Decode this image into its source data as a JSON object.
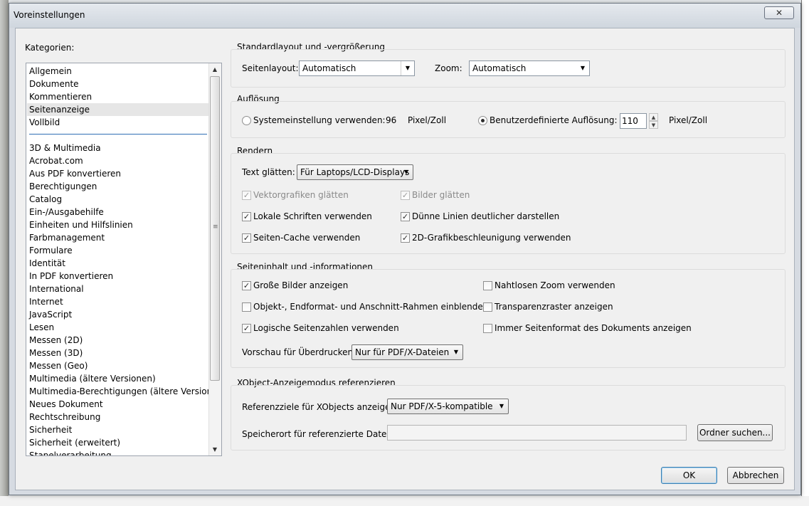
{
  "dialog": {
    "title": "Voreinstellungen",
    "close_icon": "close-icon",
    "close_glyph": "✕"
  },
  "categories": {
    "label": "Kategorien:",
    "group1": [
      "Allgemein",
      "Dokumente",
      "Kommentieren",
      "Seitenanzeige",
      "Vollbild"
    ],
    "selected": "Seitenanzeige",
    "group2": [
      "3D & Multimedia",
      "Acrobat.com",
      "Aus PDF konvertieren",
      "Berechtigungen",
      "Catalog",
      "Ein-/Ausgabehilfe",
      "Einheiten und Hilfslinien",
      "Farbmanagement",
      "Formulare",
      "Identität",
      "In PDF konvertieren",
      "International",
      "Internet",
      "JavaScript",
      "Lesen",
      "Messen (2D)",
      "Messen (3D)",
      "Messen (Geo)",
      "Multimedia (ältere Versionen)",
      "Multimedia-Berechtigungen (ältere Versionen)",
      "Neues Dokument",
      "Rechtschreibung",
      "Sicherheit",
      "Sicherheit (erweitert)",
      "Stapelverarbeitung"
    ],
    "scroll_up": "▲",
    "scroll_down": "▼",
    "grip": "≡"
  },
  "layout_section": {
    "title": "Standardlayout und -vergrößerung",
    "page_layout_label": "Seitenlayout:",
    "page_layout_value": "Automatisch",
    "zoom_label": "Zoom:",
    "zoom_value": "Automatisch"
  },
  "resolution_section": {
    "title": "Auflösung",
    "system_label": "Systemeinstellung verwenden:",
    "system_value": "96",
    "system_unit": "Pixel/Zoll",
    "custom_label": "Benutzerdefinierte Auflösung:",
    "custom_value": "110",
    "custom_unit": "Pixel/Zoll",
    "selected": "custom"
  },
  "render_section": {
    "title": "Rendern",
    "smooth_text_label": "Text glätten:",
    "smooth_text_value": "Für Laptops/LCD-Displays",
    "vector_smoothing": {
      "label": "Vektorgrafiken glätten",
      "checked": true,
      "disabled": true
    },
    "image_smoothing": {
      "label": "Bilder glätten",
      "checked": true,
      "disabled": true
    },
    "local_fonts": {
      "label": "Lokale Schriften verwenden",
      "checked": true
    },
    "thin_lines": {
      "label": "Dünne Linien deutlicher darstellen",
      "checked": true
    },
    "page_cache": {
      "label": "Seiten-Cache verwenden",
      "checked": true
    },
    "gpu_2d": {
      "label": "2D-Grafikbeschleunigung verwenden",
      "checked": true
    }
  },
  "content_section": {
    "title": "Seiteninhalt und -informationen",
    "large_images": {
      "label": "Große Bilder anzeigen",
      "checked": true
    },
    "seamless_zoom": {
      "label": "Nahtlosen Zoom verwenden",
      "checked": false
    },
    "art_trim_bleed": {
      "label": "Objekt-, Endformat- und Anschnitt-Rahmen einblenden",
      "checked": false
    },
    "transparency_grid": {
      "label": "Transparenzraster anzeigen",
      "checked": false
    },
    "logical_page_numbers": {
      "label": "Logische Seitenzahlen verwenden",
      "checked": true
    },
    "always_doc_page_size": {
      "label": "Immer Seitenformat des Dokuments anzeigen",
      "checked": false
    },
    "overprint_label": "Vorschau für Überdrucken:",
    "overprint_value": "Nur für PDF/X-Dateien"
  },
  "xobject_section": {
    "title": "XObject-Anzeigemodus referenzieren",
    "targets_label": "Referenzziele für XObjects anzeigen:",
    "targets_value": "Nur PDF/X-5-kompatible",
    "location_label": "Speicherort für referenzierte Dateien:",
    "location_value": "",
    "browse_label": "Ordner suchen..."
  },
  "footer": {
    "ok_label": "OK",
    "cancel_label": "Abbrechen"
  },
  "glyphs": {
    "checkmark": "✓",
    "dropdown_arrow": "▼",
    "spin_up": "▲",
    "spin_down": "▼"
  }
}
